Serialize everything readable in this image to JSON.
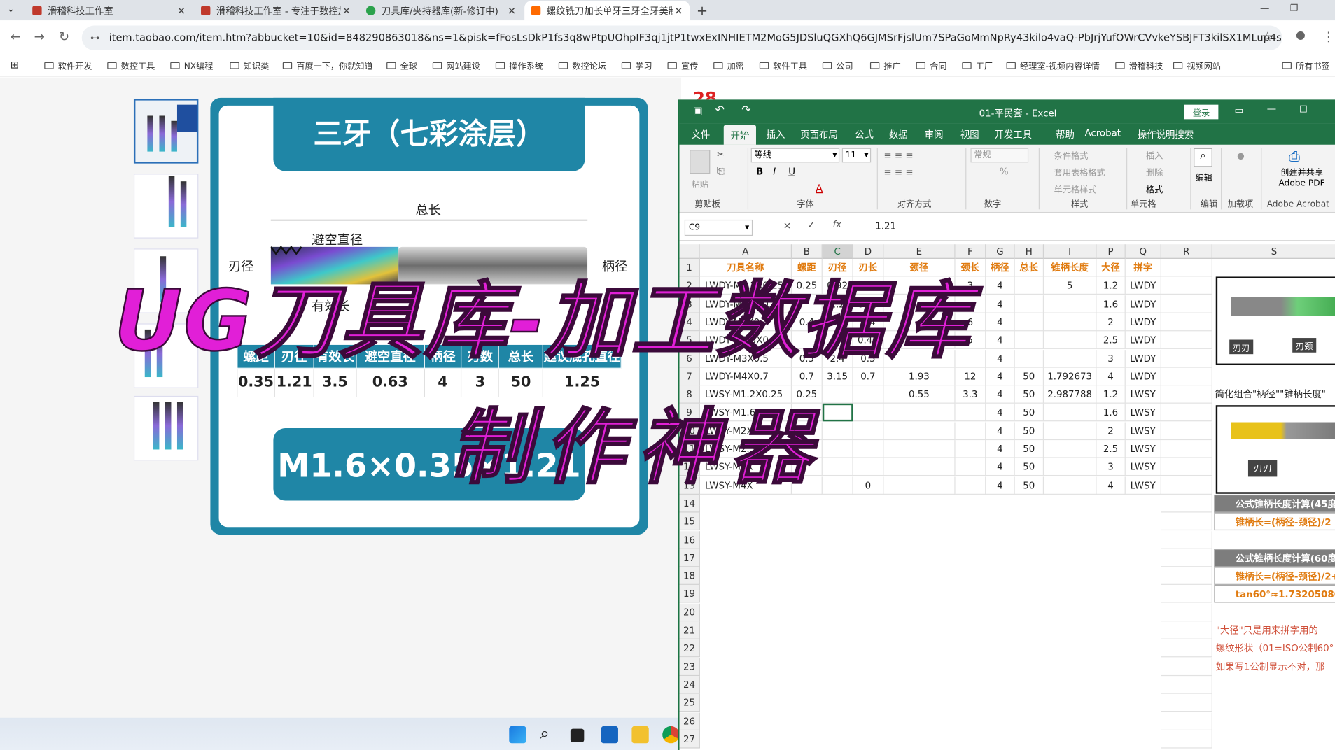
{
  "browser": {
    "tabs": [
      {
        "title": "滑稽科技工作室",
        "color": "#c0392b"
      },
      {
        "title": "滑稽科技工作室 - 专注于数控加...",
        "color": "#c0392b"
      },
      {
        "title": "刀具库/夹持器库(新-修订中)",
        "color": "#2ba24c"
      },
      {
        "title": "螺纹铣刀加长单牙三牙全牙美制...",
        "color": "#ff6a00"
      }
    ],
    "url": "item.taobao.com/item.htm?abbucket=10&id=848290863018&ns=1&pisk=fFosLsDkP1fs3q8wPtpUOhpIF3qj1jtP1twxExINHIETM2MoG5JDSluQGXhQ6GJMSrFjslUm7SPaGoMmNpRy43kilo4vaQ-PbJrjYufOWrCVvkeYSBJFT3kilSX1MLup4sOLOVQO...",
    "bookmarks": [
      "软件开发",
      "数控工具",
      "NX编程",
      "知识类",
      "百度一下，你就知道",
      "全球",
      "网站建设",
      "操作系统",
      "数控论坛",
      "学习",
      "宣传",
      "加密",
      "软件工具",
      "公司",
      "推广",
      "合同",
      "工厂",
      "经理室-视频内容详情",
      "滑稽科技",
      "视频网站"
    ],
    "bookmarks_all": "所有书签"
  },
  "product": {
    "banner": "三牙（七彩涂层）",
    "total_length": "总长",
    "neck_diameter": "避空直径",
    "blade_diameter": "刃径",
    "shank_diameter": "柄径",
    "effective_length": "有效长",
    "spec_headers": [
      "螺距",
      "刃径",
      "有效长",
      "避空直径",
      "柄径",
      "刃数",
      "总长",
      "建议底孔直径"
    ],
    "spec_values": [
      "0.35",
      "1.21",
      "3.5",
      "0.63",
      "4",
      "3",
      "50",
      "1.25"
    ],
    "model": "M1.6×0.35×1.21",
    "corner_number": "28"
  },
  "excel": {
    "title": "01-平民套  -  Excel",
    "login": "登录",
    "tabs": [
      "文件",
      "开始",
      "插入",
      "页面布局",
      "公式",
      "数据",
      "审阅",
      "视图",
      "开发工具",
      "帮助",
      "Acrobat",
      "操作说明搜索"
    ],
    "groups": [
      "剪贴板",
      "字体",
      "对齐方式",
      "数字",
      "样式",
      "单元格",
      "编辑",
      "加载项",
      "Adobe Acrobat"
    ],
    "font_name": "等线",
    "font_size": "11",
    "number_format": "常规",
    "styles": [
      "条件格式",
      "套用表格格式",
      "单元格样式"
    ],
    "cells_group": [
      "插入",
      "删除",
      "格式"
    ],
    "edit_label": "编辑",
    "addin_label": "加载项",
    "pdf_label": "创建并共享 Adobe PDF",
    "paste_label": "粘贴",
    "name_box": "C9",
    "formula": "1.21",
    "columns": [
      "A",
      "B",
      "C",
      "D",
      "E",
      "F",
      "G",
      "H",
      "I",
      "P",
      "Q",
      "R",
      "S"
    ],
    "header_row": [
      "刀具名称",
      "螺距",
      "刃径",
      "刃长",
      "颈径",
      "颈长",
      "柄径",
      "总长",
      "锥柄长度",
      "大径",
      "拼字"
    ],
    "rows": [
      [
        "LWDY-M1.2X0.25",
        "0.25",
        "0.92",
        "0.25",
        "",
        "3",
        "4",
        "",
        "5",
        "1.2",
        "LWDY"
      ],
      [
        "LWDY-M1.6X0.35",
        "",
        "1.2",
        "0.35",
        "",
        "",
        "4",
        "",
        "",
        "1.6",
        "LWDY"
      ],
      [
        "LWDY-M2X0.4",
        "0.4",
        "1.54",
        "0.4",
        "",
        "6",
        "4",
        "",
        "",
        "2",
        "LWDY"
      ],
      [
        "LWDY-M2.5X0.45",
        "",
        "",
        "0.45",
        "",
        "5",
        "4",
        "",
        "",
        "2.5",
        "LWDY"
      ],
      [
        "LWDY-M3X0.5",
        "0.5",
        "2.4",
        "0.5",
        "",
        "",
        "4",
        "",
        "",
        "3",
        "LWDY"
      ],
      [
        "LWDY-M4X0.7",
        "0.7",
        "3.15",
        "0.7",
        "1.93",
        "12",
        "4",
        "50",
        "1.792673",
        "4",
        "LWDY"
      ],
      [
        "LWSY-M1.2X0.25",
        "0.25",
        "",
        "",
        "0.55",
        "3.3",
        "4",
        "50",
        "2.987788",
        "1.2",
        "LWSY"
      ],
      [
        "LWSY-M1.6X0.35",
        "0.35",
        "",
        "",
        "",
        "",
        "4",
        "50",
        "",
        "1.6",
        "LWSY"
      ],
      [
        "LWSY-M2X",
        "",
        "",
        "",
        "",
        "",
        "4",
        "50",
        "",
        "2",
        "LWSY"
      ],
      [
        "LWSY-M2.5X",
        "",
        "",
        "",
        "",
        "",
        "4",
        "50",
        "",
        "2.5",
        "LWSY"
      ],
      [
        "LWSY-M3X",
        "",
        "",
        "",
        "",
        "",
        "4",
        "50",
        "",
        "3",
        "LWSY"
      ],
      [
        "LWSY-M4X",
        "",
        "",
        "0",
        "",
        "",
        "4",
        "50",
        "",
        "4",
        "LWSY"
      ]
    ],
    "row_numbers": [
      "1",
      "2",
      "3",
      "4",
      "5",
      "6",
      "7",
      "8",
      "9",
      "10",
      "11",
      "12",
      "13",
      "14",
      "15",
      "16",
      "17",
      "18",
      "19",
      "20",
      "21",
      "22",
      "23",
      "24",
      "25",
      "26",
      "27"
    ],
    "side_img1_labels": [
      "刃刃",
      "刃颈"
    ],
    "side_caption": "简化组合\"柄径\"\"锥柄长度\"",
    "side_img2_label": "刃刃",
    "formula1_title": "公式锥柄长度计算(45度)",
    "formula1_text": "锥柄长=(柄径-颈径)/2",
    "formula2_title": "公式锥柄长度计算(60度)",
    "formula2_text": "锥柄长=(柄径-颈径)/2+tan",
    "formula2_value": "tan60°≈1.73205080",
    "note1": "\"大径\"只是用来拼字用的",
    "note2": "螺纹形状（01=ISO公制60°",
    "note3": "如果写1公制显示不对，那"
  },
  "overlay": {
    "line1": "UG刀具库-加工数据库",
    "line2": "制作神器"
  },
  "colors": {
    "brand": "#1f86a6",
    "excel": "#217346",
    "overlay": "#e11fd7",
    "header_orange": "#e07b10"
  }
}
